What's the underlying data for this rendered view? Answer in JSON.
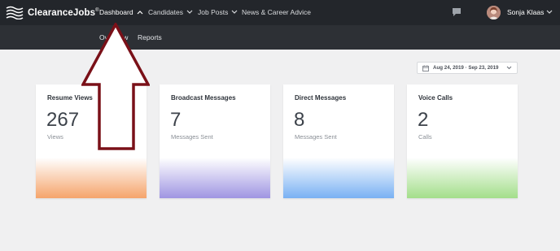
{
  "brand": {
    "name": "ClearanceJobs",
    "reg": "®"
  },
  "nav": {
    "items": [
      {
        "label": "Dashboard",
        "active": true
      },
      {
        "label": "Candidates"
      },
      {
        "label": "Job Posts"
      },
      {
        "label": "News & Career Advice"
      }
    ]
  },
  "user": {
    "name": "Sonja Klaas"
  },
  "subnav": {
    "items": [
      {
        "label": "Overview"
      },
      {
        "label": "Reports"
      }
    ]
  },
  "date_range": {
    "label": "Aug 24, 2019  ·  Sep 23, 2019"
  },
  "cards": [
    {
      "title": "Resume Views",
      "value": "267",
      "unit": "Views",
      "color": "#f5a46b"
    },
    {
      "title": "Broadcast Messages",
      "value": "7",
      "unit": "Messages Sent",
      "color": "#9f95e2"
    },
    {
      "title": "Direct Messages",
      "value": "8",
      "unit": "Messages Sent",
      "color": "#79b1f3"
    },
    {
      "title": "Voice Calls",
      "value": "2",
      "unit": "Calls",
      "color": "#a3de8a"
    }
  ],
  "colors": {
    "topbar": "#23262b",
    "subbar": "#2d3035",
    "arrow": "#7a1018"
  }
}
